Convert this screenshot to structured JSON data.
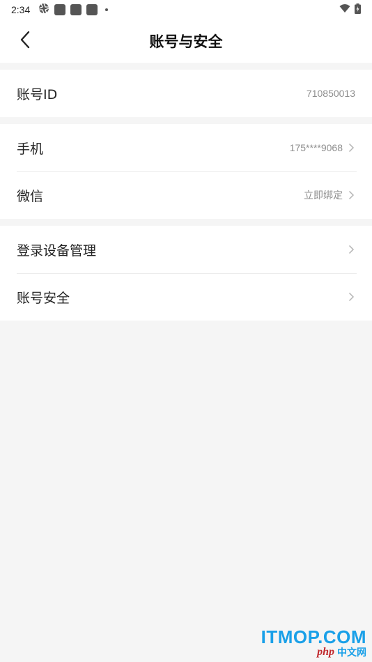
{
  "status_bar": {
    "time": "2:34",
    "icons_left": [
      "aperture-icon",
      "notification-square-icon",
      "notification-square-icon",
      "notification-square-icon",
      "dot-icon"
    ],
    "icons_right": [
      "wifi-icon",
      "battery-icon"
    ]
  },
  "header": {
    "title": "账号与安全",
    "back_icon": "chevron-left-icon"
  },
  "groups": [
    {
      "rows": [
        {
          "label": "账号ID",
          "value": "710850013",
          "has_arrow": false
        }
      ]
    },
    {
      "rows": [
        {
          "label": "手机",
          "value": "175****9068",
          "has_arrow": true
        },
        {
          "label": "微信",
          "value": "立即绑定",
          "has_arrow": true
        }
      ]
    },
    {
      "rows": [
        {
          "label": "登录设备管理",
          "value": "",
          "has_arrow": true
        },
        {
          "label": "账号安全",
          "value": "",
          "has_arrow": true
        }
      ]
    }
  ],
  "watermark": {
    "main": "ITMOP.COM",
    "php": "php",
    "cn": "中文网"
  },
  "colors": {
    "background": "#f5f5f5",
    "card": "#ffffff",
    "text_primary": "#222222",
    "text_secondary": "#8e8e8e",
    "divider": "#ececec",
    "watermark_blue": "#1aa0e8",
    "watermark_red": "#c0282d"
  }
}
